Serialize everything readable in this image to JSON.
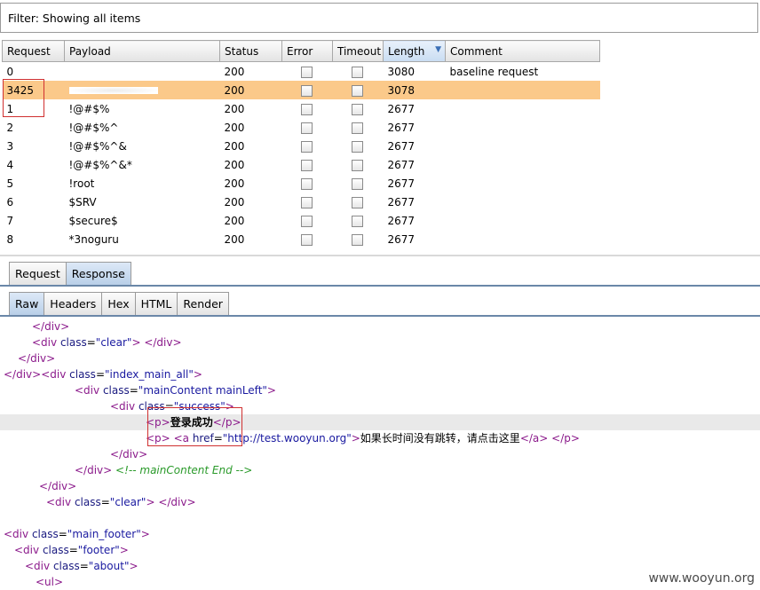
{
  "filter": {
    "label": "Filter: Showing all items"
  },
  "table": {
    "columns": [
      "Request",
      "Payload",
      "Status",
      "Error",
      "Timeout",
      "Length",
      "Comment"
    ],
    "sorted_column": "Length",
    "rows": [
      {
        "request": "0",
        "payload": "",
        "status": "200",
        "length": "3080",
        "comment": "baseline request",
        "selected": false,
        "payload_obscured": false
      },
      {
        "request": "3425",
        "payload": "",
        "status": "200",
        "length": "3078",
        "comment": "",
        "selected": true,
        "payload_obscured": true
      },
      {
        "request": "1",
        "payload": "!@#$%",
        "status": "200",
        "length": "2677",
        "comment": "",
        "selected": false,
        "payload_obscured": false
      },
      {
        "request": "2",
        "payload": "!@#$%^",
        "status": "200",
        "length": "2677",
        "comment": "",
        "selected": false,
        "payload_obscured": false
      },
      {
        "request": "3",
        "payload": "!@#$%^&",
        "status": "200",
        "length": "2677",
        "comment": "",
        "selected": false,
        "payload_obscured": false
      },
      {
        "request": "4",
        "payload": "!@#$%^&*",
        "status": "200",
        "length": "2677",
        "comment": "",
        "selected": false,
        "payload_obscured": false
      },
      {
        "request": "5",
        "payload": "!root",
        "status": "200",
        "length": "2677",
        "comment": "",
        "selected": false,
        "payload_obscured": false
      },
      {
        "request": "6",
        "payload": "$SRV",
        "status": "200",
        "length": "2677",
        "comment": "",
        "selected": false,
        "payload_obscured": false
      },
      {
        "request": "7",
        "payload": "$secure$",
        "status": "200",
        "length": "2677",
        "comment": "",
        "selected": false,
        "payload_obscured": false
      },
      {
        "request": "8",
        "payload": "*3noguru",
        "status": "200",
        "length": "2677",
        "comment": "",
        "selected": false,
        "payload_obscured": false
      }
    ]
  },
  "tabs_top": [
    {
      "label": "Request",
      "active": false
    },
    {
      "label": "Response",
      "active": true
    }
  ],
  "tabs_sub": [
    {
      "label": "Raw",
      "active": true
    },
    {
      "label": "Headers",
      "active": false
    },
    {
      "label": "Hex",
      "active": false
    },
    {
      "label": "HTML",
      "active": false
    },
    {
      "label": "Render",
      "active": false
    }
  ],
  "code_lines": [
    {
      "indent": 36,
      "html": "<span class='tg'>&lt;/div&gt;</span>"
    },
    {
      "indent": 36,
      "html": "<span class='tg'>&lt;div</span> <span class='at'>class</span>=<span class='vl'>\"clear\"</span><span class='tg'>&gt;</span> <span class='tg'>&lt;/div&gt;</span>"
    },
    {
      "indent": 20,
      "html": "<span class='tg'>&lt;/div&gt;</span>"
    },
    {
      "indent": 4,
      "html": "<span class='tg'>&lt;/div&gt;&lt;div</span> <span class='at'>class</span>=<span class='vl'>\"index_main_all\"</span><span class='tg'>&gt;</span>"
    },
    {
      "indent": 84,
      "html": "<span class='tg'>&lt;div</span> <span class='at'>class</span>=<span class='vl'>\"mainContent mainLeft\"</span><span class='tg'>&gt;</span>"
    },
    {
      "indent": 124,
      "html": "<span class='tg'>&lt;div</span> <span class='at'>class</span>=<span class='vl'>\"success\"</span><span class='tg'>&gt;</span>"
    },
    {
      "indent": 164,
      "hl": true,
      "html": "<span class='tg'>&lt;p&gt;</span><span class='bd'>登录成功</span><span class='tg'>&lt;/p&gt;</span>"
    },
    {
      "indent": 164,
      "html": "<span class='tg'>&lt;p&gt;</span> <span class='tg'>&lt;a</span> <span class='at'>href</span>=<span class='vl'>\"http://test.wooyun.org\"</span><span class='tg'>&gt;</span>如果长时间没有跳转，请点击这里<span class='tg'>&lt;/a&gt;</span> <span class='tg'>&lt;/p&gt;</span>"
    },
    {
      "indent": 124,
      "html": "<span class='tg'>&lt;/div&gt;</span>"
    },
    {
      "indent": 84,
      "html": "<span class='tg'>&lt;/div&gt;</span> <span class='cm'>&lt;!-- mainContent End --&gt;</span>"
    },
    {
      "indent": 44,
      "html": "<span class='tg'>&lt;/div&gt;</span>"
    },
    {
      "indent": 52,
      "html": "<span class='tg'>&lt;div</span> <span class='at'>class</span>=<span class='vl'>\"clear\"</span><span class='tg'>&gt;</span> <span class='tg'>&lt;/div&gt;</span>"
    },
    {
      "indent": 0,
      "html": ""
    },
    {
      "indent": 4,
      "html": "<span class='tg'>&lt;div</span> <span class='at'>class</span>=<span class='vl'>\"main_footer\"</span><span class='tg'>&gt;</span>"
    },
    {
      "indent": 16,
      "html": "<span class='tg'>&lt;div</span> <span class='at'>class</span>=<span class='vl'>\"footer\"</span><span class='tg'>&gt;</span>"
    },
    {
      "indent": 28,
      "html": "<span class='tg'>&lt;div</span> <span class='at'>class</span>=<span class='vl'>\"about\"</span><span class='tg'>&gt;</span>"
    },
    {
      "indent": 40,
      "html": "<span class='tg'>&lt;ul&gt;</span>"
    }
  ],
  "watermark": "www.wooyun.org"
}
